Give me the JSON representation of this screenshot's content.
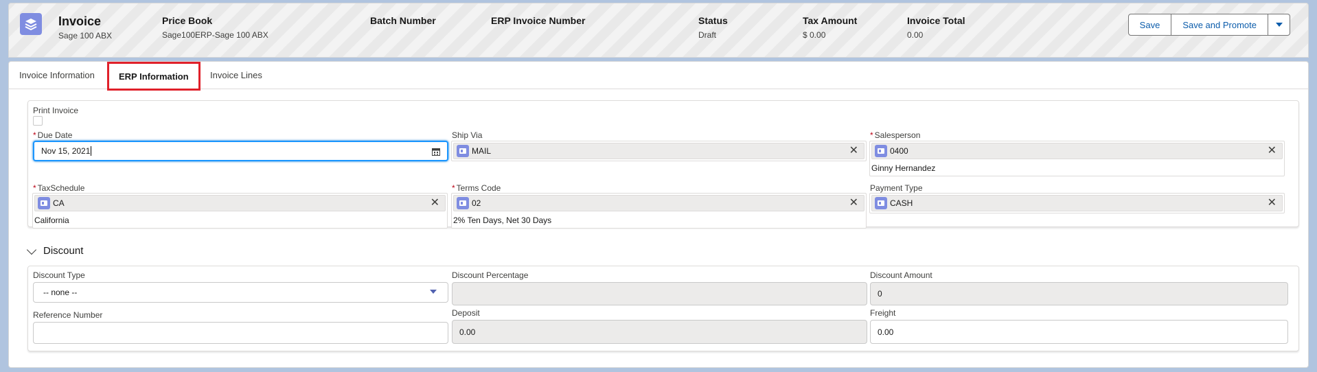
{
  "header": {
    "title": "Invoice",
    "subtitle": "Sage 100 ABX",
    "fields": [
      {
        "label": "Price Book",
        "value": "Sage100ERP-Sage 100 ABX"
      },
      {
        "label": "Batch Number",
        "value": ""
      },
      {
        "label": "ERP Invoice Number",
        "value": ""
      },
      {
        "label": "Status",
        "value": "Draft"
      },
      {
        "label": "Tax Amount",
        "value": "$ 0.00"
      },
      {
        "label": "Invoice Total",
        "value": "0.00"
      }
    ],
    "buttons": {
      "save": "Save",
      "save_promote": "Save and Promote"
    }
  },
  "tabs": [
    {
      "label": "Invoice Information"
    },
    {
      "label": "ERP Information",
      "active": true
    },
    {
      "label": "Invoice Lines"
    }
  ],
  "erp": {
    "print_invoice_label": "Print Invoice",
    "due_date_label": "Due Date",
    "due_date_value": "Nov 15, 2021",
    "ship_via_label": "Ship Via",
    "ship_via_value": "MAIL",
    "salesperson_label": "Salesperson",
    "salesperson_value": "0400",
    "salesperson_name": "Ginny Hernandez",
    "tax_schedule_label": "TaxSchedule",
    "tax_schedule_value": "CA",
    "tax_schedule_name": "California",
    "terms_code_label": "Terms Code",
    "terms_code_value": "02",
    "terms_code_desc": "2% Ten Days, Net 30 Days",
    "payment_type_label": "Payment Type",
    "payment_type_value": "CASH"
  },
  "discount": {
    "section_title": "Discount",
    "discount_type_label": "Discount Type",
    "discount_type_value": "-- none --",
    "discount_pct_label": "Discount Percentage",
    "discount_pct_value": "",
    "discount_amount_label": "Discount Amount",
    "discount_amount_value": "0",
    "reference_label": "Reference Number",
    "reference_value": "",
    "deposit_label": "Deposit",
    "deposit_value": "0.00",
    "freight_label": "Freight",
    "freight_value": "0.00"
  },
  "colors": {
    "accent": "#0b5cab",
    "icon_bg": "#7f8de1",
    "highlight": "#e0202a",
    "required": "#ba0517"
  }
}
